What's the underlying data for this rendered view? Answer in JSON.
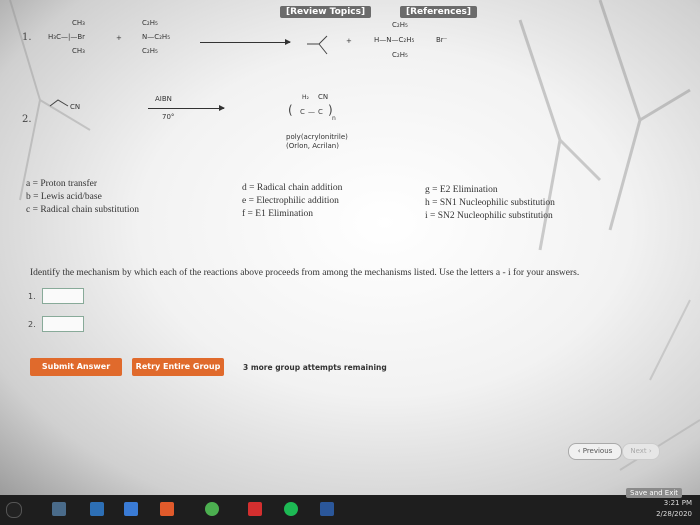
{
  "header": {
    "review_topics": "[Review Topics]",
    "references": "[References]"
  },
  "question1": {
    "number": "1.",
    "reactant1_top": "CH₃",
    "reactant1_mid": "H₃C—|—Br",
    "reactant1_bottom": "CH₃",
    "plus1": "+",
    "reactant2_top": "C₂H₅",
    "reactant2_mid": "N—C₂H₅",
    "reactant2_bottom": "C₂H₅",
    "plus2": "+",
    "product2_top": "C₂H₅",
    "product2_mid": "H—N—C₂H₅",
    "product2_bottom": "C₂H₅",
    "product2_ion": "Br⁻"
  },
  "question2": {
    "number": "2.",
    "reactant": "CN",
    "reagent_top": "AIBN",
    "reagent_bottom": "70°",
    "product_cn": "CN",
    "product_chain": "H₂",
    "product_n": "n",
    "product_name1": "poly(acrylonitrile)",
    "product_name2": "(Orlon, Acrilan)"
  },
  "legend": {
    "a": "a = Proton transfer",
    "b": "b = Lewis acid/base",
    "c": "c = Radical chain substitution",
    "d": "d = Radical chain addition",
    "e": "e = Electrophilic addition",
    "f": "f = E1 Elimination",
    "g": "g = E2 Elimination",
    "h": "h = SN1 Nucleophilic substitution",
    "i": "i = SN2 Nucleophilic substitution"
  },
  "instruction": "Identify the mechanism by which each of the reactions above proceeds from among the mechanisms listed. Use the letters a - i for your answers.",
  "answers": {
    "label1": "1.",
    "label2": "2.",
    "value1": "",
    "value2": ""
  },
  "buttons": {
    "submit": "Submit Answer",
    "retry": "Retry Entire Group",
    "attempts": "3 more group attempts remaining"
  },
  "nav": {
    "previous": "Previous",
    "next": "Next",
    "save_exit": "Save and Exit"
  },
  "taskbar": {
    "time": "3:21 PM",
    "date": "2/28/2020"
  }
}
